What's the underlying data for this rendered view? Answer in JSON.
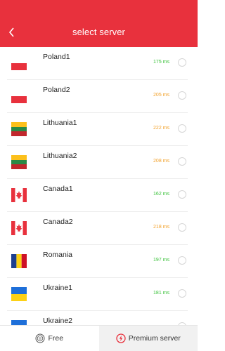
{
  "header": {
    "title": "select server"
  },
  "servers": [
    {
      "name": "Poland1",
      "ping": "175 ms",
      "ping_color": "#3bc23b",
      "flag": "poland-flag-icon"
    },
    {
      "name": "Poland2",
      "ping": "205 ms",
      "ping_color": "#f2a12a",
      "flag": "poland-flag-icon"
    },
    {
      "name": "Lithuania1",
      "ping": "222 ms",
      "ping_color": "#f2a12a",
      "flag": "lithuania-flag-icon"
    },
    {
      "name": "Lithuania2",
      "ping": "208 ms",
      "ping_color": "#f2a12a",
      "flag": "lithuania-flag-icon"
    },
    {
      "name": "Canada1",
      "ping": "162 ms",
      "ping_color": "#3bc23b",
      "flag": "canada-flag-icon"
    },
    {
      "name": "Canada2",
      "ping": "218 ms",
      "ping_color": "#f2a12a",
      "flag": "canada-flag-icon"
    },
    {
      "name": "Romania",
      "ping": "197 ms",
      "ping_color": "#3bc23b",
      "flag": "romania-flag-icon"
    },
    {
      "name": "Ukraine1",
      "ping": "181 ms",
      "ping_color": "#3bc23b",
      "flag": "ukraine-flag-icon"
    },
    {
      "name": "Ukraine2",
      "ping": "",
      "ping_color": "#3bc23b",
      "flag": "ukraine-flag-icon"
    }
  ],
  "tabs": {
    "free_label": "Free",
    "premium_label": "Premium server"
  },
  "colors": {
    "brand": "#e8313d",
    "ping_good": "#3bc23b",
    "ping_warn": "#f2a12a"
  }
}
